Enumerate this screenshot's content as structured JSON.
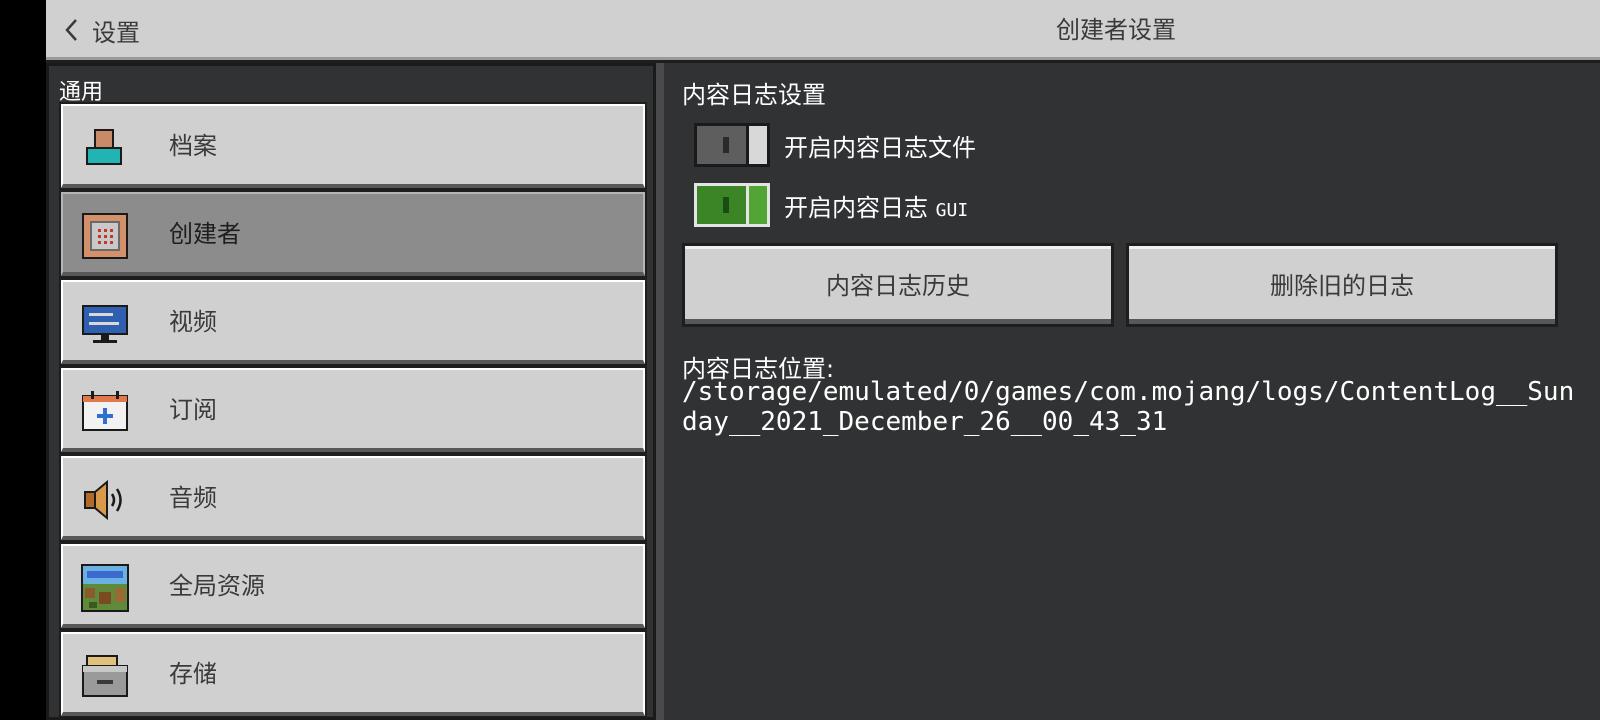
{
  "header": {
    "back_label": "设置",
    "title": "创建者设置"
  },
  "sidebar": {
    "section_label": "通用",
    "items": [
      {
        "label": "档案",
        "icon": "profile-icon",
        "active": false
      },
      {
        "label": "创建者",
        "icon": "command-block-icon",
        "active": true
      },
      {
        "label": "视频",
        "icon": "monitor-icon",
        "active": false
      },
      {
        "label": "订阅",
        "icon": "subscription-icon",
        "active": false
      },
      {
        "label": "音频",
        "icon": "speaker-icon",
        "active": false
      },
      {
        "label": "全局资源",
        "icon": "resource-pack-icon",
        "active": false
      },
      {
        "label": "存储",
        "icon": "storage-icon",
        "active": false
      }
    ]
  },
  "content": {
    "heading": "内容日志设置",
    "toggles": [
      {
        "label": "开启内容日志文件",
        "on": false
      },
      {
        "label_prefix": "开启内容日志 ",
        "label_suffix": "GUI",
        "on": true
      }
    ],
    "buttons": {
      "history": "内容日志历史",
      "delete_old": "删除旧的日志"
    },
    "location_label": "内容日志位置:",
    "location_path": "/storage/emulated/0/games/com.mojang/logs/ContentLog__Sunday__2021_December_26__00_43_31"
  },
  "colors": {
    "toggle_on": "#3c8527",
    "button_bg": "#d0d0d0",
    "panel_bg": "#313233"
  }
}
